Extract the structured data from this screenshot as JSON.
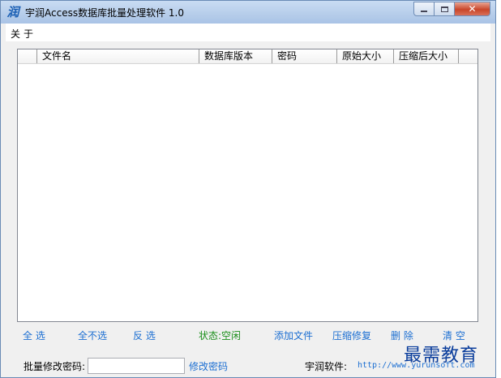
{
  "window": {
    "title": "宇润Access数据库批量处理软件 1.0",
    "icon_glyph": "润"
  },
  "menu": {
    "items": [
      {
        "label": "关于"
      }
    ]
  },
  "table": {
    "columns": [
      "文件名",
      "数据库版本",
      "密码",
      "原始大小",
      "压缩后大小"
    ],
    "rows": []
  },
  "actions": {
    "select_all": "全 选",
    "select_none": "全不选",
    "invert": "反 选",
    "status": "状态:空闲",
    "add_file": "添加文件",
    "compact_repair": "压缩修复",
    "delete": "删 除",
    "clear": "清 空"
  },
  "bottom": {
    "batch_password_label": "批量修改密码:",
    "password_value": "",
    "change_password_link": "修改密码",
    "company_label": "宇润软件:",
    "company_url": "http://www.yurunsoft.com"
  },
  "watermark": "最需教育",
  "colors": {
    "link": "#1c6fd2",
    "status": "#1a8f1a",
    "close_button": "#c9462a"
  }
}
